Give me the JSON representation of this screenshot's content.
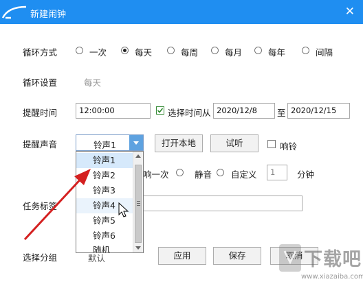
{
  "window": {
    "title": "新建闹钟",
    "close_glyph": "✕"
  },
  "loop_mode": {
    "label": "循环方式",
    "options": [
      "一次",
      "每天",
      "每周",
      "每月",
      "每年",
      "间隔"
    ],
    "selected": "每天"
  },
  "loop_setting": {
    "label": "循环设置",
    "value": "每天"
  },
  "remind_time": {
    "label": "提醒时间",
    "time": "12:00:00",
    "range_checkbox_label": "选择时间从",
    "range_checked": true,
    "start_date": "2020/12/8",
    "to_label": "至",
    "end_date": "2020/12/15"
  },
  "remind_sound": {
    "label": "提醒声音",
    "selected": "铃声1",
    "open_local_label": "打开本地",
    "preview_label": "试听",
    "ring_label": "响铃",
    "ring_checked": false,
    "options": [
      "铃声1",
      "铃声2",
      "铃声3",
      "铃声4",
      "铃声5",
      "铃声6",
      "随机"
    ],
    "highlighted": "铃声1",
    "hovered": "铃声4"
  },
  "play_mode": {
    "partial_once": "响一次",
    "mute_label": "静音",
    "custom_label": "自定义",
    "custom_value": "1",
    "minutes_label": "分钟"
  },
  "task_tag": {
    "label": "任务标签",
    "value": ""
  },
  "group": {
    "label": "选择分组",
    "value": "默认"
  },
  "actions": {
    "apply": "应用",
    "save": "保存",
    "cancel": "取消"
  },
  "watermark": {
    "text": "下载吧",
    "url": "www.xiazaiba.com"
  }
}
